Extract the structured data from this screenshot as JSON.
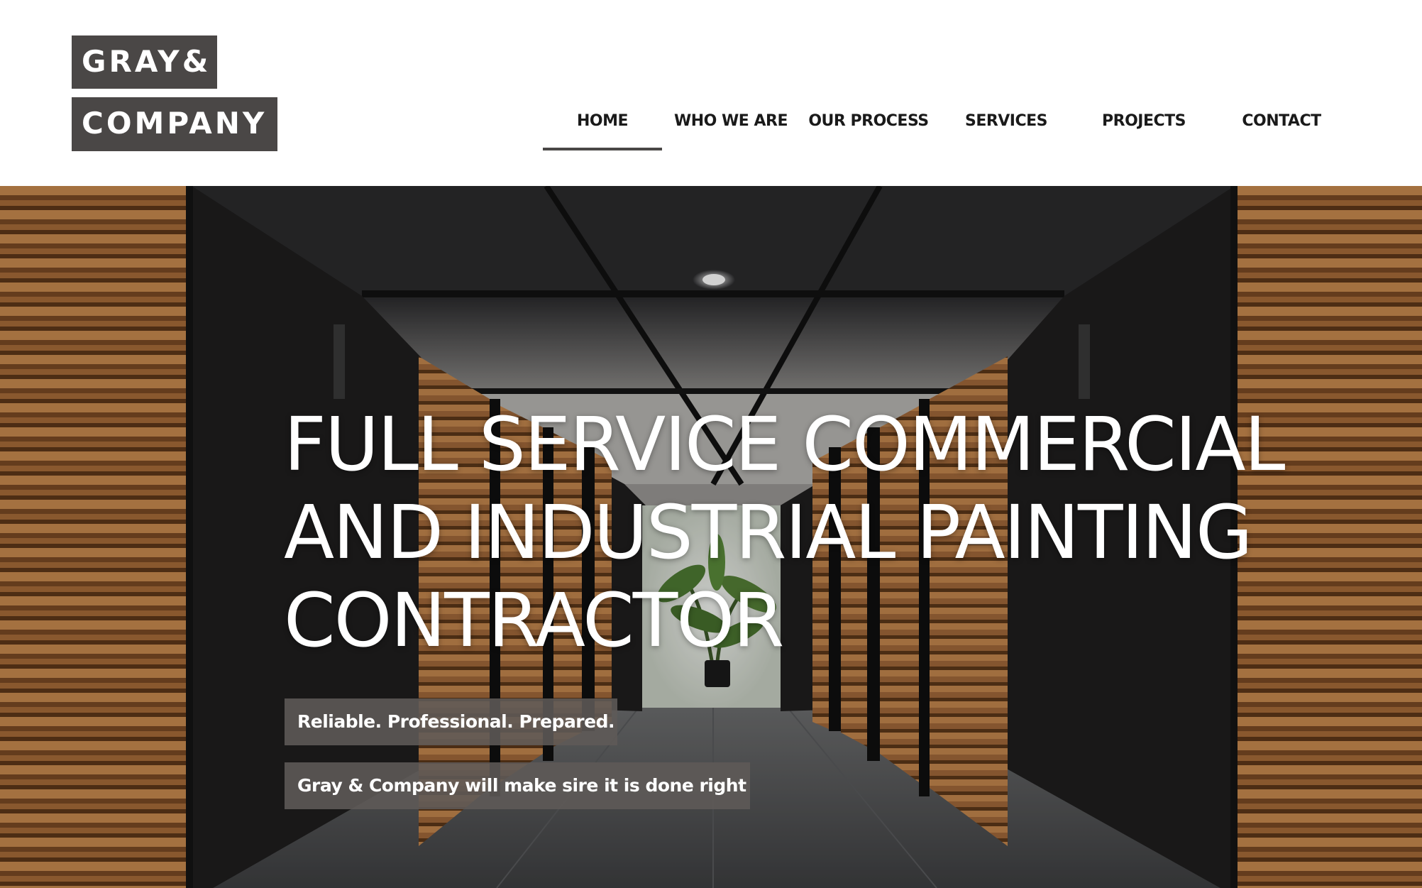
{
  "logo": {
    "line1": "GRAY&",
    "line2": "COMPANY"
  },
  "nav": {
    "items": [
      {
        "label": "HOME",
        "active": true
      },
      {
        "label": "WHO WE ARE",
        "active": false
      },
      {
        "label": "OUR PROCESS",
        "active": false
      },
      {
        "label": "SERVICES",
        "active": false
      },
      {
        "label": "PROJECTS",
        "active": false
      },
      {
        "label": "CONTACT",
        "active": false
      }
    ]
  },
  "hero": {
    "title_lines": [
      "FULL SERVICE COMMERCIAL",
      "AND INDUSTRIAL PAINTING",
      "CONTRACTOR"
    ],
    "tagline": "Reliable. Professional. Prepared.",
    "subtagline": "Gray & Company will make sire it is done right",
    "image": "elevator-lobby-corridor-photo"
  },
  "colors": {
    "logo_bg": "#4a4746",
    "nav_text": "#1a1a1a",
    "nav_active_underline": "#4a4746",
    "tag_bg": "#5f5a58",
    "hero_text": "#ffffff",
    "wood_panel": "#b5763f"
  }
}
